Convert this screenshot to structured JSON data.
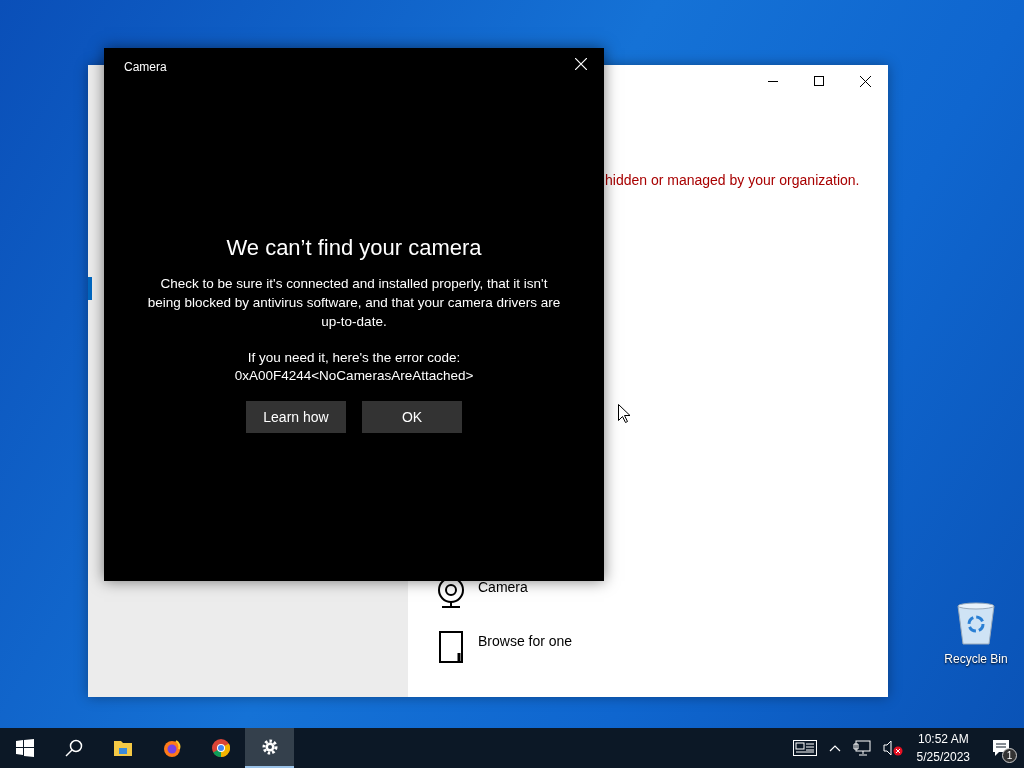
{
  "desktop_icons": [
    {
      "label": "Recycle Bin"
    }
  ],
  "settings_window": {
    "notice": "hidden or managed by your organization.",
    "options": [
      {
        "kind": "camera",
        "label": "Camera"
      },
      {
        "kind": "browse",
        "label": "Browse for one"
      }
    ]
  },
  "dialog": {
    "title": "Camera",
    "heading": "We can’t find your camera",
    "message": "Check to be sure it's connected and installed properly, that it isn't being blocked by antivirus software, and that your camera drivers are up-to-date.",
    "error_intro": "If you need it, here's the error code:",
    "error_code": "0xA00F4244<NoCamerasAreAttached>",
    "buttons": [
      "Learn how",
      "OK"
    ]
  },
  "taskbar": {
    "apps": [
      {
        "kind": "start",
        "selected": false
      },
      {
        "kind": "search",
        "selected": false
      },
      {
        "kind": "files",
        "selected": false
      },
      {
        "kind": "firefox",
        "selected": false
      },
      {
        "kind": "chrome",
        "selected": false
      },
      {
        "kind": "settings",
        "selected": true
      }
    ],
    "clock": {
      "time": "10:52 AM",
      "date": "5/25/2023"
    },
    "notification_count": "1"
  }
}
